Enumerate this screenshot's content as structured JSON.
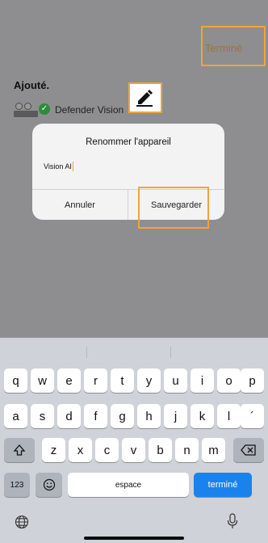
{
  "header": {
    "done_label": "Terminé"
  },
  "section": {
    "title": "Ajouté."
  },
  "device": {
    "name": "Defender Vision"
  },
  "dialog": {
    "title": "Renommer l'appareil",
    "input_value": "Vision AI",
    "cancel_label": "Annuler",
    "save_label": "Sauvegarder"
  },
  "keyboard": {
    "row1": [
      "q",
      "w",
      "e",
      "r",
      "t",
      "y",
      "u",
      "i",
      "o",
      "p"
    ],
    "row2": [
      "a",
      "s",
      "d",
      "f",
      "g",
      "h",
      "j",
      "k",
      "l",
      "´"
    ],
    "row3": [
      "z",
      "x",
      "c",
      "v",
      "b",
      "n",
      "m"
    ],
    "numbers_label": "123",
    "space_label": "espace",
    "return_label": "terminé"
  },
  "colors": {
    "highlight": "#f0a43a",
    "return_key": "#1a82ec",
    "done_text": "#a0733a"
  }
}
